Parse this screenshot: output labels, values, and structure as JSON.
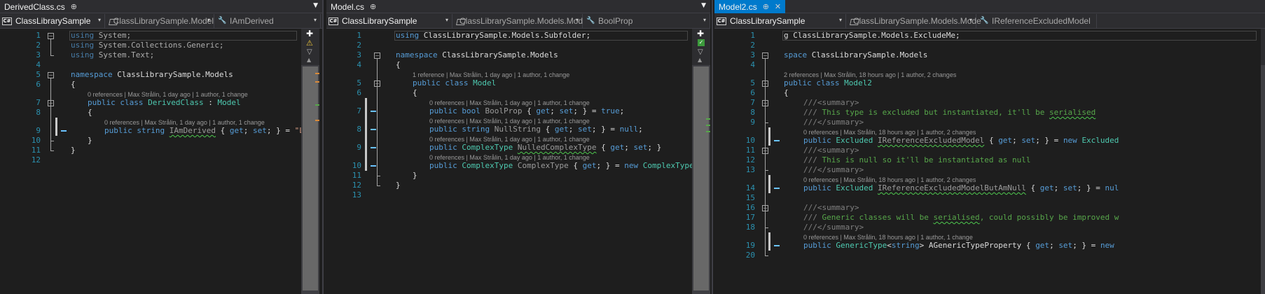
{
  "panes": [
    {
      "tab": {
        "label": "DerivedClass.cs",
        "pin": "⊕",
        "active": false
      },
      "nav": {
        "project": "ClassLibrarySample",
        "type": "ClassLibrarySample.Model",
        "member": "IAmDerived"
      },
      "lines": [
        {
          "n": "1",
          "code": [
            [
              "kw",
              "using"
            ],
            [
              "",
              "System;"
            ]
          ],
          "fade": true
        },
        {
          "n": "2",
          "code": [
            [
              "kw",
              "using"
            ],
            [
              "",
              "System.Collections.Generic;"
            ]
          ],
          "fade": true
        },
        {
          "n": "3",
          "code": [
            [
              "kw",
              "using"
            ],
            [
              "",
              "System.Text;"
            ]
          ],
          "fade": true
        },
        {
          "n": "4",
          "code": []
        },
        {
          "n": "5",
          "code": [
            [
              "kw",
              "namespace"
            ],
            [
              "",
              "ClassLibrarySample.Models"
            ]
          ]
        },
        {
          "n": "6",
          "code": [
            [
              "",
              "{"
            ]
          ]
        },
        {
          "n": "7",
          "lens": "0 references | Max Strålin, 1 day ago | 1 author, 1 change",
          "code": [
            [
              "kw",
              "public class"
            ],
            [
              "ty",
              "DerivedClass"
            ],
            [
              "",
              ":"
            ],
            [
              "ty",
              "Model"
            ]
          ]
        },
        {
          "n": "8",
          "code": [
            [
              "",
              "{"
            ]
          ]
        },
        {
          "n": "9",
          "lens": "0 references | Max Strålin, 1 day ago | 1 author, 1 change",
          "code": [
            [
              "kw",
              "public string"
            ],
            [
              "dimsq",
              "IAmDerived"
            ],
            [
              "",
              "{"
            ],
            [
              "kw",
              "get"
            ],
            [
              "",
              ";"
            ],
            [
              "kw",
              "set"
            ],
            [
              "",
              "; } ="
            ],
            [
              "st",
              "\"Like"
            ]
          ]
        },
        {
          "n": "10",
          "code": [
            [
              "",
              "}"
            ]
          ]
        },
        {
          "n": "11",
          "code": [
            [
              "",
              "}"
            ]
          ]
        },
        {
          "n": "12",
          "code": []
        }
      ]
    },
    {
      "tab": {
        "label": "Model.cs",
        "pin": "⊕",
        "active": false
      },
      "nav": {
        "project": "ClassLibrarySample",
        "type": "ClassLibrarySample.Models.Mod",
        "member": "BoolProp"
      },
      "lines": [
        {
          "n": "1",
          "code": [
            [
              "kw",
              "using"
            ],
            [
              "",
              "ClassLibrarySample.Models.Subfolder;"
            ]
          ]
        },
        {
          "n": "2",
          "code": []
        },
        {
          "n": "3",
          "code": [
            [
              "kw",
              "namespace"
            ],
            [
              "",
              "ClassLibrarySample.Models"
            ]
          ]
        },
        {
          "n": "4",
          "code": [
            [
              "",
              "{"
            ]
          ]
        },
        {
          "n": "5",
          "lens": "1 reference | Max Strålin, 1 day ago | 1 author, 1 change",
          "code": [
            [
              "kw",
              "public class"
            ],
            [
              "ty",
              "Model"
            ]
          ]
        },
        {
          "n": "6",
          "code": [
            [
              "",
              "{"
            ]
          ]
        },
        {
          "n": "7",
          "lens": "0 references | Max Strålin, 1 day ago | 1 author, 1 change",
          "code": [
            [
              "kw",
              "public bool"
            ],
            [
              "dim",
              "BoolProp"
            ],
            [
              "",
              "{"
            ],
            [
              "kw",
              "get"
            ],
            [
              "",
              ";"
            ],
            [
              "kw",
              "set"
            ],
            [
              "",
              "; } ="
            ],
            [
              "kw",
              "true"
            ],
            [
              "",
              ";"
            ]
          ]
        },
        {
          "n": "8",
          "lens": "0 references | Max Strålin, 1 day ago | 1 author, 1 change",
          "code": [
            [
              "kw",
              "public string"
            ],
            [
              "dim",
              "NullString"
            ],
            [
              "",
              "{"
            ],
            [
              "kw",
              "get"
            ],
            [
              "",
              ";"
            ],
            [
              "kw",
              "set"
            ],
            [
              "",
              "; } ="
            ],
            [
              "kw",
              "null"
            ],
            [
              "",
              ";"
            ]
          ]
        },
        {
          "n": "9",
          "lens": "0 references | Max Strålin, 1 day ago | 1 author, 1 change",
          "code": [
            [
              "kw",
              "public"
            ],
            [
              "ty",
              "ComplexType"
            ],
            [
              "dimsq",
              "NulledComplexType"
            ],
            [
              "",
              "{"
            ],
            [
              "kw",
              "get"
            ],
            [
              "",
              ";"
            ],
            [
              "kw",
              "set"
            ],
            [
              "",
              "; }"
            ]
          ]
        },
        {
          "n": "10",
          "lens": "0 references | Max Strålin, 1 day ago | 1 author, 1 change",
          "code": [
            [
              "kw",
              "public"
            ],
            [
              "ty",
              "ComplexType"
            ],
            [
              "dim",
              "ComplexType"
            ],
            [
              "",
              "{"
            ],
            [
              "kw",
              "get"
            ],
            [
              "",
              "; } ="
            ],
            [
              "kw",
              "new"
            ],
            [
              "ty",
              "ComplexType"
            ],
            [
              "",
              "();"
            ]
          ]
        },
        {
          "n": "11",
          "code": [
            [
              "",
              "}"
            ]
          ]
        },
        {
          "n": "12",
          "code": [
            [
              "",
              "}"
            ]
          ]
        },
        {
          "n": "13",
          "code": []
        }
      ]
    },
    {
      "tab": {
        "label": "Model2.cs",
        "pin": "⊕",
        "close": "✕",
        "active": true
      },
      "nav": {
        "project": "ClassLibrarySample",
        "type": "ClassLibrarySample.Models.Mode",
        "member": "IReferenceExcludedModel"
      },
      "lines": [
        {
          "n": "1",
          "code": [
            [
              "",
              "g ClassLibrarySample.Models.ExcludeMe;"
            ]
          ]
        },
        {
          "n": "2",
          "code": []
        },
        {
          "n": "3",
          "code": [
            [
              "kw",
              "space"
            ],
            [
              "",
              "ClassLibrarySample.Models"
            ]
          ]
        },
        {
          "n": "4",
          "code": []
        },
        {
          "n": "5",
          "lens": "2 references | Max Strålin, 18 hours ago | 1 author, 2 changes",
          "code": [
            [
              "kw",
              "public class"
            ],
            [
              "ty",
              "Model2"
            ]
          ]
        },
        {
          "n": "6",
          "code": [
            [
              "",
              "{"
            ]
          ]
        },
        {
          "n": "7",
          "code": [
            [
              "gy",
              "///"
            ],
            [
              "gy",
              "<summary>"
            ]
          ]
        },
        {
          "n": "8",
          "code": [
            [
              "gy",
              "///"
            ],
            [
              "cm",
              "This type is excluded but instantiated, it'll be"
            ],
            [
              "cmsq",
              "serialised"
            ]
          ]
        },
        {
          "n": "9",
          "code": [
            [
              "gy",
              "///"
            ],
            [
              "gy",
              "</summary>"
            ]
          ]
        },
        {
          "n": "10",
          "lens": "0 references | Max Strålin, 18 hours ago | 1 author, 2 changes",
          "code": [
            [
              "kw",
              "public"
            ],
            [
              "ty",
              "Excluded"
            ],
            [
              "dimsq",
              "IReferenceExcludedModel"
            ],
            [
              "",
              "{"
            ],
            [
              "kw",
              "get"
            ],
            [
              "",
              ";"
            ],
            [
              "kw",
              "set"
            ],
            [
              "",
              "; } ="
            ],
            [
              "kw",
              "new"
            ],
            [
              "ty",
              "Excluded"
            ]
          ]
        },
        {
          "n": "11",
          "code": [
            [
              "gy",
              "///"
            ],
            [
              "gy",
              "<summary>"
            ]
          ]
        },
        {
          "n": "12",
          "code": [
            [
              "gy",
              "///"
            ],
            [
              "cm",
              "This is null so it'll be instantiated as null"
            ]
          ]
        },
        {
          "n": "13",
          "code": [
            [
              "gy",
              "///"
            ],
            [
              "gy",
              "</summary>"
            ]
          ]
        },
        {
          "n": "14",
          "lens": "0 references | Max Strålin, 18 hours ago | 1 author, 2 changes",
          "code": [
            [
              "kw",
              "public"
            ],
            [
              "ty",
              "Excluded"
            ],
            [
              "dimsq",
              "IReferenceExcludedModelButAmNull"
            ],
            [
              "",
              "{"
            ],
            [
              "kw",
              "get"
            ],
            [
              "",
              ";"
            ],
            [
              "kw",
              "set"
            ],
            [
              "",
              "; } ="
            ],
            [
              "kw",
              "nul"
            ]
          ]
        },
        {
          "n": "15",
          "code": []
        },
        {
          "n": "16",
          "code": [
            [
              "gy",
              "///"
            ],
            [
              "gy",
              "<summary>"
            ]
          ]
        },
        {
          "n": "17",
          "code": [
            [
              "gy",
              "///"
            ],
            [
              "cm",
              "Generic classes will be"
            ],
            [
              "cmsq",
              "serialised"
            ],
            [
              "cm",
              ", could possibly be improved w"
            ]
          ]
        },
        {
          "n": "18",
          "code": [
            [
              "gy",
              "///"
            ],
            [
              "gy",
              "</summary>"
            ]
          ]
        },
        {
          "n": "19",
          "lens": "0 references | Max Strålin, 18 hours ago | 1 author, 1 change",
          "code": [
            [
              "kw",
              "public"
            ],
            [
              "ty",
              "GenericType"
            ],
            [
              "",
              "<"
            ],
            [
              "kw",
              "string"
            ],
            [
              "",
              "> AGenericTypeProperty {"
            ],
            [
              "kw",
              "get"
            ],
            [
              "",
              ";"
            ],
            [
              "kw",
              "set"
            ],
            [
              "",
              "; } ="
            ],
            [
              "kw",
              "new"
            ]
          ]
        },
        {
          "n": "20",
          "code": []
        }
      ]
    }
  ],
  "tab_dropdown_icon": "▼",
  "nav_dropdown_icon": "▾",
  "fold_collapse_icon": "−",
  "colors": {
    "keyword": "#569cd6",
    "type": "#4ec9b0",
    "comment": "#57a64a",
    "string": "#d69d85",
    "line_number": "#2b91af",
    "active_tab": "#007acc"
  }
}
